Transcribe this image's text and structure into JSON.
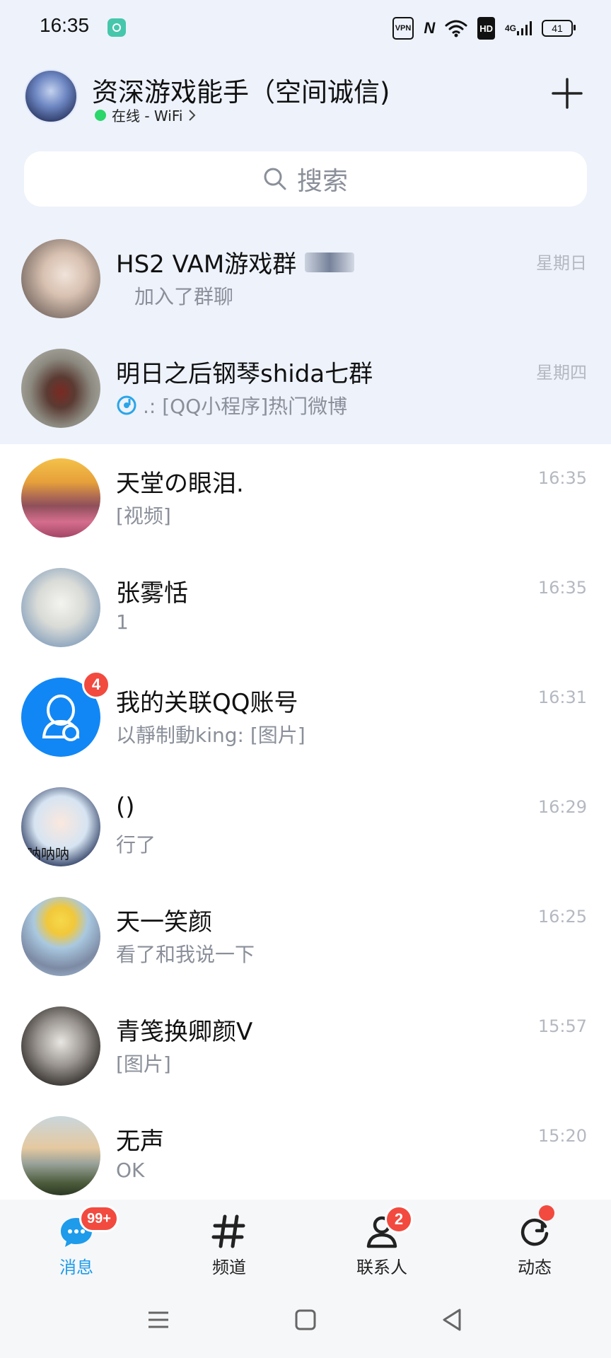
{
  "status_bar": {
    "time": "16:35",
    "vpn": "VPN",
    "hd": "HD",
    "network": "4G",
    "battery": "41"
  },
  "header": {
    "name": "资深游戏能手（空间诚信)",
    "status": "在线 - WiFi"
  },
  "search": {
    "placeholder": "搜索"
  },
  "conversations": [
    {
      "title": "HS2   VAM游戏群",
      "preview": "加入了群聊",
      "time": "星期日",
      "pinned": true
    },
    {
      "title": "明日之后钢琴shida七群",
      "preview": ".: [QQ小程序]热门微博",
      "time": "星期四",
      "pinned": true
    },
    {
      "title": "天堂の眼泪.",
      "preview": "[视频]",
      "time": "16:35"
    },
    {
      "title": "张雾恬",
      "preview": "1",
      "time": "16:35"
    },
    {
      "title": "我的关联QQ账号",
      "preview": "以靜制動king: [图片]",
      "time": "16:31",
      "badge": "4"
    },
    {
      "title": "()",
      "preview": "行了",
      "time": "16:29",
      "avatar_text": "呐呐呐"
    },
    {
      "title": "天一笑颜",
      "preview": "看了和我说一下",
      "time": "16:25"
    },
    {
      "title": "青笺换卿颜V",
      "preview": "[图片]",
      "time": "15:57"
    },
    {
      "title": "无声",
      "preview": "OK",
      "time": "15:20"
    }
  ],
  "bottom_nav": {
    "messages": {
      "label": "消息",
      "badge": "99+"
    },
    "channels": {
      "label": "频道"
    },
    "contacts": {
      "label": "联系人",
      "badge": "2"
    },
    "moments": {
      "label": "动态"
    }
  },
  "colors": {
    "accent": "#1e9bea",
    "badge": "#f24a3f",
    "online": "#2bd66b",
    "pinned_bg": "#edf2fb"
  }
}
